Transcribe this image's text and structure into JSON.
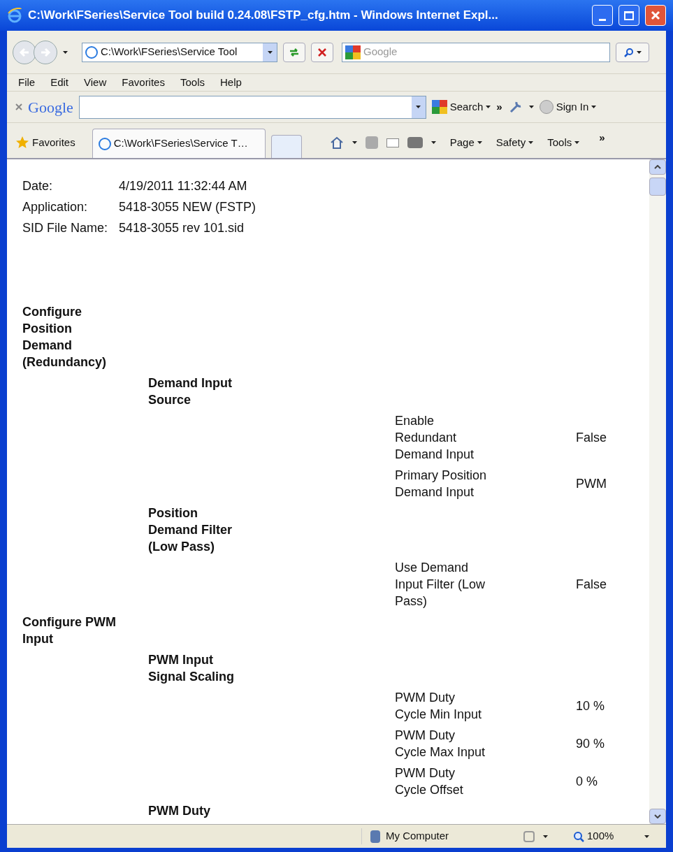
{
  "window": {
    "title": "C:\\Work\\FSeries\\Service Tool build 0.24.08\\FSTP_cfg.htm - Windows Internet Expl..."
  },
  "address": {
    "value": "C:\\Work\\FSeries\\Service Tool"
  },
  "search": {
    "placeholder": "Google"
  },
  "menu": [
    "File",
    "Edit",
    "View",
    "Favorites",
    "Tools",
    "Help"
  ],
  "google_toolbar": {
    "logo": "Google",
    "search_button": "Search",
    "more": "»",
    "sign_in": "Sign In"
  },
  "favorites_bar": {
    "favorites": "Favorites",
    "tab": "C:\\Work\\FSeries\\Service T…",
    "commands": [
      "Page",
      "Safety",
      "Tools"
    ],
    "more": "»"
  },
  "document": {
    "info": [
      {
        "label": "Date:",
        "value": "4/19/2011 11:32:44 AM"
      },
      {
        "label": "Application:",
        "value": "5418-3055 NEW (FSTP)"
      },
      {
        "label": "SID File Name:",
        "value": "5418-3055 rev 101.sid"
      }
    ],
    "sections": [
      {
        "title": "Configure Position Demand (Redundancy)",
        "children": [
          {
            "title": "Demand Input Source",
            "children": [
              {
                "name": "Enable Redundant Demand Input",
                "value": "False"
              },
              {
                "name": "Primary Position Demand Input",
                "value": "PWM"
              }
            ]
          },
          {
            "title": "Position Demand Filter (Low Pass)",
            "children": [
              {
                "name": "Use Demand Input Filter (Low Pass)",
                "value": "False"
              }
            ]
          }
        ]
      },
      {
        "title": "Configure PWM Input",
        "children": [
          {
            "title": "PWM Input Signal Scaling",
            "children": [
              {
                "name": "PWM Duty Cycle Min Input",
                "value": "10 %"
              },
              {
                "name": "PWM Duty Cycle Max Input",
                "value": "90 %"
              },
              {
                "name": "PWM Duty Cycle Offset",
                "value": "0 %"
              }
            ]
          },
          {
            "title": "PWM Duty"
          }
        ]
      }
    ]
  },
  "status_bar": {
    "zone": "My Computer",
    "zoom": "100%"
  }
}
